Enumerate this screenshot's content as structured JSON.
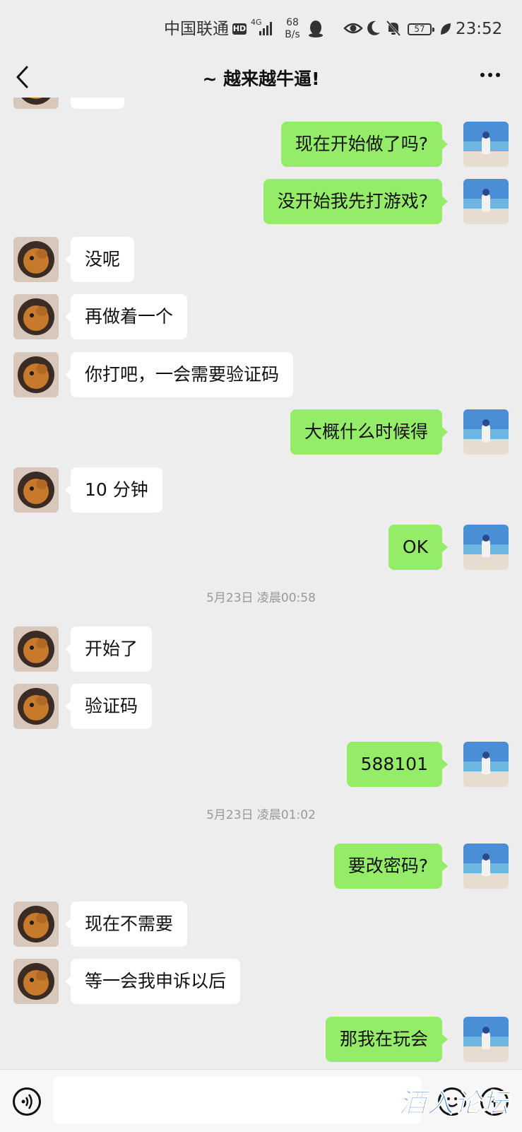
{
  "status_bar": {
    "carrier": "中国联通",
    "hd": "HD",
    "network": "4G",
    "speed_value": "68",
    "speed_unit": "B/s",
    "battery": "57",
    "time": "23:52"
  },
  "header": {
    "back_icon": "chevron-left-icon",
    "title": "~ 越来越牛逼!",
    "more_icon": "ellipsis-icon"
  },
  "messages": [
    {
      "side": "right",
      "text": "现在开始做了吗?"
    },
    {
      "side": "right",
      "text": "没开始我先打游戏?"
    },
    {
      "side": "left",
      "text": "没呢"
    },
    {
      "side": "left",
      "text": "再做着一个"
    },
    {
      "side": "left",
      "text": "你打吧，一会需要验证码"
    },
    {
      "side": "right",
      "text": "大概什么时候得"
    },
    {
      "side": "left",
      "text": "10 分钟"
    },
    {
      "side": "right",
      "text": "OK"
    },
    {
      "type": "time",
      "text": "5月23日 凌晨00:58"
    },
    {
      "side": "left",
      "text": "开始了"
    },
    {
      "side": "left",
      "text": "验证码"
    },
    {
      "side": "right",
      "text": "588101"
    },
    {
      "type": "time",
      "text": "5月23日 凌晨01:02"
    },
    {
      "side": "right",
      "text": "要改密码?"
    },
    {
      "side": "left",
      "text": "现在不需要"
    },
    {
      "side": "left",
      "text": "等一会我申诉以后"
    },
    {
      "side": "right",
      "text": "那我在玩会"
    }
  ],
  "input_bar": {
    "voice_icon": "voice-icon",
    "emoji_icon": "emoji-icon",
    "plus_icon": "plus-icon"
  },
  "watermark": "酒入论坛",
  "colors": {
    "background": "#ededed",
    "sent_bubble": "#95ec69",
    "received_bubble": "#ffffff",
    "watermark": "#2a6fd8"
  }
}
